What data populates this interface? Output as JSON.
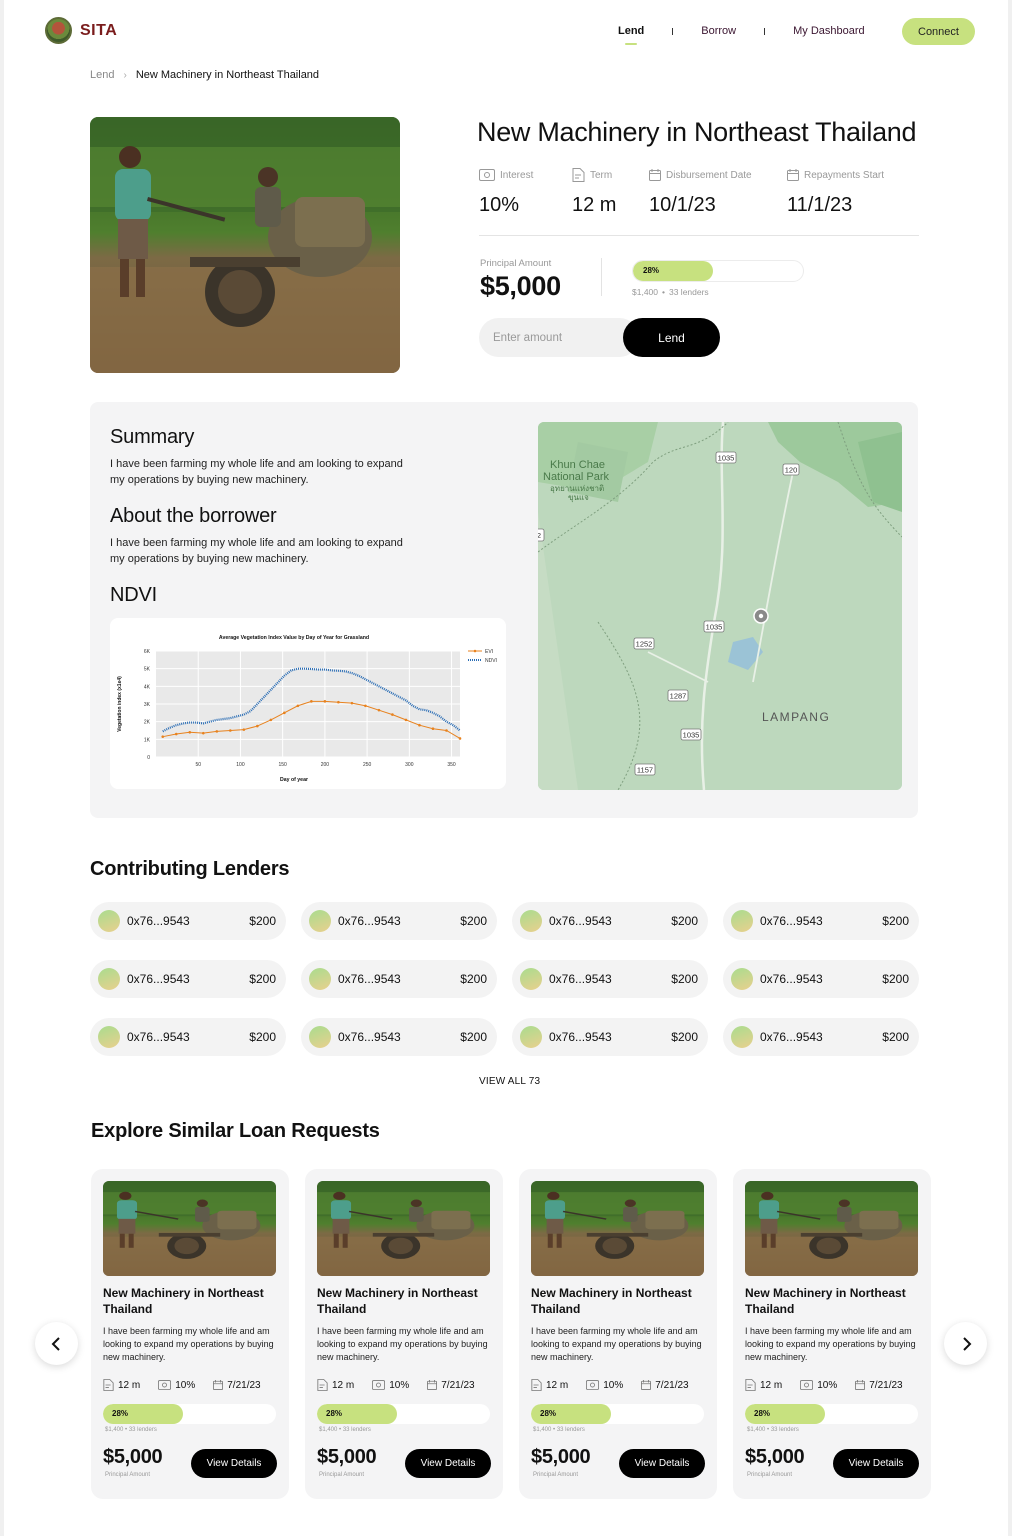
{
  "brand": {
    "name": "SITA"
  },
  "nav": {
    "links": [
      "Lend",
      "Borrow",
      "My Dashboard"
    ],
    "connect": "Connect"
  },
  "breadcrumb": {
    "home": "Lend",
    "sep": "›",
    "current": "New Machinery in Northeast Thailand"
  },
  "loan": {
    "title": "New Machinery in Northeast Thailand",
    "stats": [
      {
        "label": "Interest",
        "value": "10%",
        "icon": "money-icon"
      },
      {
        "label": "Term",
        "value": "12 m",
        "icon": "document-icon"
      },
      {
        "label": "Disbursement Date",
        "value": "10/1/23",
        "icon": "calendar-icon"
      },
      {
        "label": "Repayments Start",
        "value": "11/1/23",
        "icon": "calendar-icon"
      }
    ],
    "principal_label": "Principal Amount",
    "principal_value": "$5,000",
    "progress_pct": "28%",
    "progress_fraction": 0.47,
    "raised": "$1,400",
    "lenders": "33 lenders",
    "dot": "•",
    "amount_placeholder": "Enter amount",
    "lend_label": "Lend"
  },
  "details": {
    "summary_title": "Summary",
    "summary_text": "I have been farming my whole life and am looking to expand my operations by buying new machinery.",
    "about_title": "About the borrower",
    "about_text": "I have been farming my whole life and am looking to expand my operations by buying new machinery.",
    "ndvi_title": "NDVI"
  },
  "map": {
    "park_label_1": "Khun Chae",
    "park_label_2": "National Park",
    "park_label_th_1": "อุทยานแห่งชาติ",
    "park_label_th_2": "ขุนแจ",
    "city": "LAMPANG",
    "roads": [
      "1035",
      "120",
      "2",
      "1252",
      "1035",
      "1287",
      "1035",
      "1157"
    ]
  },
  "chart_data": {
    "type": "line",
    "title": "Average Vegetation Index Value by Day of Year for Grassland",
    "xlabel": "Day of year",
    "ylabel": "Vegetation index (x1e4)",
    "xlim": [
      0,
      360
    ],
    "ylim": [
      0,
      6000
    ],
    "x_ticks": [
      "50",
      "100",
      "150",
      "200",
      "250",
      "300",
      "350"
    ],
    "y_ticks": [
      "0",
      "1K",
      "2K",
      "3K",
      "4K",
      "5K",
      "6K"
    ],
    "legend_position": "top-right",
    "grid": true,
    "series": [
      {
        "name": "EVI",
        "color": "#e8821e",
        "x": [
          8,
          24,
          40,
          56,
          72,
          88,
          104,
          120,
          136,
          152,
          168,
          184,
          200,
          216,
          232,
          248,
          264,
          280,
          296,
          312,
          328,
          344,
          360
        ],
        "values": [
          1150,
          1300,
          1400,
          1350,
          1450,
          1500,
          1550,
          1750,
          2100,
          2500,
          2900,
          3150,
          3150,
          3100,
          3050,
          2900,
          2650,
          2400,
          2100,
          1800,
          1600,
          1500,
          1050
        ]
      },
      {
        "name": "NDVI",
        "color": "#2a6db5",
        "x": [
          8,
          16,
          24,
          32,
          40,
          48,
          56,
          64,
          72,
          80,
          88,
          96,
          104,
          112,
          120,
          128,
          136,
          144,
          152,
          160,
          168,
          176,
          184,
          192,
          200,
          208,
          216,
          224,
          232,
          240,
          248,
          256,
          264,
          272,
          280,
          288,
          296,
          304,
          312,
          320,
          328,
          336,
          344,
          352,
          360
        ],
        "values": [
          1450,
          1650,
          1800,
          1900,
          1950,
          1950,
          1900,
          2000,
          2100,
          2150,
          2200,
          2300,
          2400,
          2600,
          3000,
          3400,
          3800,
          4200,
          4600,
          4900,
          5000,
          5000,
          4980,
          4950,
          4950,
          4900,
          4880,
          4850,
          4750,
          4600,
          4400,
          4200,
          4000,
          3800,
          3600,
          3400,
          3200,
          2900,
          2700,
          2650,
          2500,
          2300,
          2000,
          1800,
          1500
        ]
      }
    ]
  },
  "lenders": {
    "title": "Contributing Lenders",
    "items": [
      {
        "address": "0x76...9543",
        "amount": "$200"
      },
      {
        "address": "0x76...9543",
        "amount": "$200"
      },
      {
        "address": "0x76...9543",
        "amount": "$200"
      },
      {
        "address": "0x76...9543",
        "amount": "$200"
      },
      {
        "address": "0x76...9543",
        "amount": "$200"
      },
      {
        "address": "0x76...9543",
        "amount": "$200"
      },
      {
        "address": "0x76...9543",
        "amount": "$200"
      },
      {
        "address": "0x76...9543",
        "amount": "$200"
      },
      {
        "address": "0x76...9543",
        "amount": "$200"
      },
      {
        "address": "0x76...9543",
        "amount": "$200"
      },
      {
        "address": "0x76...9543",
        "amount": "$200"
      },
      {
        "address": "0x76...9543",
        "amount": "$200"
      }
    ],
    "view_all": "VIEW ALL 73"
  },
  "similar": {
    "title": "Explore Similar Loan Requests",
    "cards": [
      {
        "title": "New Machinery in Northeast Thailand",
        "desc": "I have been farming my whole life and am looking to expand my operations by buying new machinery.",
        "term": "12 m",
        "interest": "10%",
        "date": "7/21/23",
        "pct": "28%",
        "fraction": 0.46,
        "raised": "$1,400",
        "lenders": "33 lenders",
        "price": "$5,000",
        "price_label": "Principal Amount",
        "button": "View Details"
      },
      {
        "title": "New Machinery in Northeast Thailand",
        "desc": "I have been farming my whole life and am looking to expand my operations by buying new machinery.",
        "term": "12 m",
        "interest": "10%",
        "date": "7/21/23",
        "pct": "28%",
        "fraction": 0.46,
        "raised": "$1,400",
        "lenders": "33 lenders",
        "price": "$5,000",
        "price_label": "Principal Amount",
        "button": "View Details"
      },
      {
        "title": "New Machinery in Northeast Thailand",
        "desc": "I have been farming my whole life and am looking to expand my operations by buying new machinery.",
        "term": "12 m",
        "interest": "10%",
        "date": "7/21/23",
        "pct": "28%",
        "fraction": 0.46,
        "raised": "$1,400",
        "lenders": "33 lenders",
        "price": "$5,000",
        "price_label": "Principal Amount",
        "button": "View Details"
      },
      {
        "title": "New Machinery in Northeast Thailand",
        "desc": "I have been farming my whole life and am looking to expand my operations by buying new machinery.",
        "term": "12 m",
        "interest": "10%",
        "date": "7/21/23",
        "pct": "28%",
        "fraction": 0.46,
        "raised": "$1,400",
        "lenders": "33 lenders",
        "price": "$5,000",
        "price_label": "Principal Amount",
        "button": "View Details"
      }
    ],
    "prev_icon": "chevron-left-icon",
    "next_icon": "chevron-right-icon"
  },
  "colors": {
    "accent": "#c7e17f",
    "dark": "#000000",
    "panel": "#f4f4f5",
    "brand": "#7a1c1c"
  }
}
